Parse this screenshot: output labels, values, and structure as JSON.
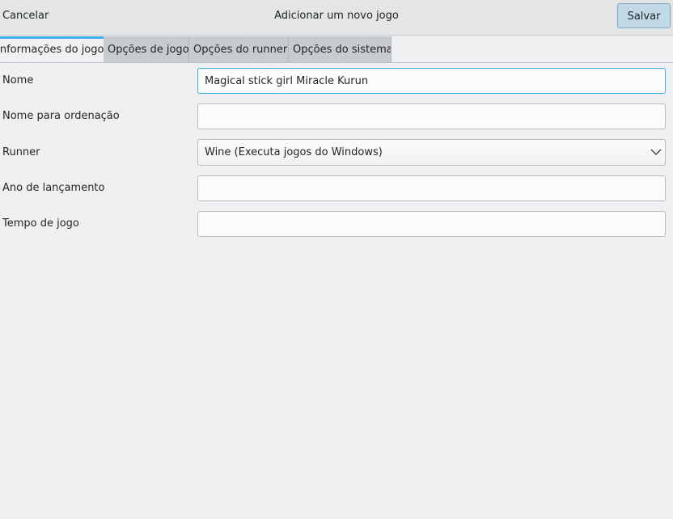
{
  "header": {
    "cancel_label": "Cancelar",
    "title": "Adicionar um novo jogo",
    "save_label": "Salvar"
  },
  "tabs": [
    {
      "label": "Informações do jogo",
      "active": true
    },
    {
      "label": "Opções de jogo",
      "active": false
    },
    {
      "label": "Opções do runner",
      "active": false
    },
    {
      "label": "Opções do sistema",
      "active": false
    }
  ],
  "form": {
    "name": {
      "label": "Nome",
      "value": "Magical stick girl Miracle Kurun"
    },
    "sort_name": {
      "label": "Nome para ordenação",
      "value": ""
    },
    "runner": {
      "label": "Runner",
      "selected": "Wine (Executa jogos do Windows)"
    },
    "year": {
      "label": "Ano de lançamento",
      "value": ""
    },
    "playtime": {
      "label": "Tempo de jogo",
      "value": ""
    }
  },
  "colors": {
    "accent": "#3daee9",
    "save_button_bg": "#c2d9e8",
    "window_bg": "#eff0f1"
  },
  "icons": {
    "runner_dropdown": "chevron-down-icon"
  }
}
